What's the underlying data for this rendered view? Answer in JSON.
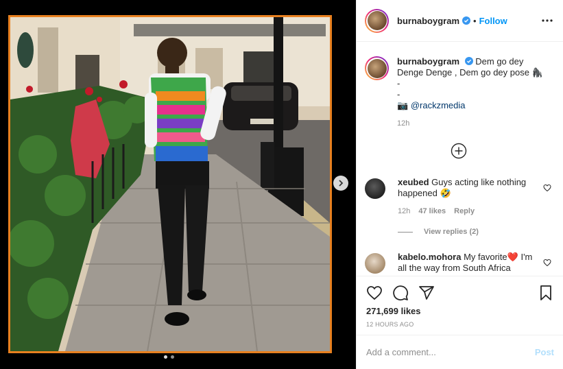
{
  "post": {
    "username": "burnaboygram",
    "follow_label": "Follow",
    "bullet": "•",
    "caption_text": "Dem go dey Denge Denge , Dem go dey pose 🦍",
    "caption_dash1": "-",
    "caption_dash2": "-",
    "caption_camera": "📷",
    "caption_mention": "@rackzmedia",
    "caption_time": "12h",
    "likes": "271,699 likes",
    "posted": "12 HOURS AGO"
  },
  "comments": [
    {
      "username": "xeubed",
      "text": "Guys acting like nothing happened 🤣",
      "time": "12h",
      "likes": "47 likes",
      "reply": "Reply",
      "view_replies": "View replies (2)"
    },
    {
      "username": "kabelo.mohora",
      "text": "My favorite❤️ I'm all the way from South Africa"
    }
  ],
  "composer": {
    "placeholder": "Add a comment...",
    "post_label": "Post"
  },
  "colors": {
    "accent": "#0095f6",
    "frame": "#e8801f",
    "post_disabled": "#b2dffc"
  },
  "icons": [
    "verified-badge-icon",
    "more-options-icon",
    "next-arrow-icon",
    "load-more-icon",
    "heart-icon",
    "comment-icon",
    "share-icon",
    "bookmark-icon"
  ]
}
